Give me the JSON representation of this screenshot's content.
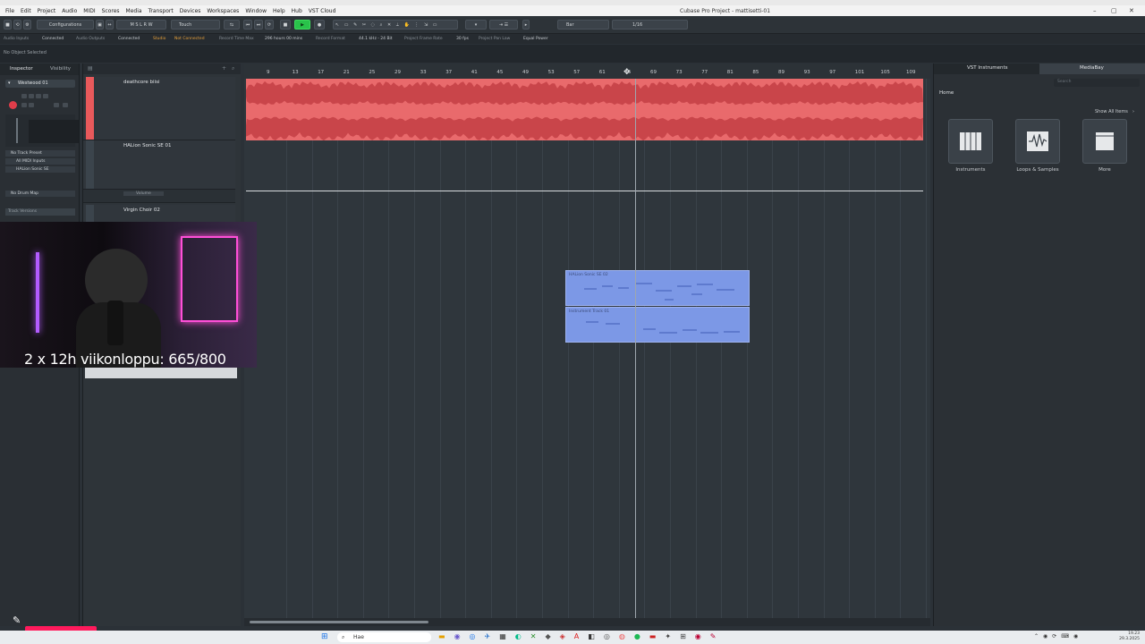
{
  "menubar": {
    "items": [
      "File",
      "Edit",
      "Project",
      "Audio",
      "MIDI",
      "Scores",
      "Media",
      "Transport",
      "Devices",
      "Workspaces",
      "Window",
      "Help",
      "Hub",
      "VST Cloud"
    ],
    "window_title": "Cubase Pro Project - mattisetti-01"
  },
  "toolbar": {
    "configurations": "Configurations",
    "touch_mode": "Touch",
    "grid_type": "Bar",
    "quantize": "1/16"
  },
  "statusline": [
    "Audio Inputs",
    "Connected",
    "Audio Outputs",
    "Connected",
    "Studio",
    "Not Connected",
    "Record Time Max",
    "296 hours 00 mins",
    "Record Format",
    "44.1 kHz - 24 Bit",
    "Project Frame Rate",
    "30 fps",
    "Project Pan Law",
    "Equal Power"
  ],
  "infoline": {
    "text": "No Object Selected"
  },
  "inspector": {
    "tabs": [
      "Inspector",
      "Visibility"
    ],
    "track_name": "Westwood 01",
    "routing": [
      "No Track Preset",
      "All MIDI Inputs",
      "HALion Sonic SE",
      "No Drum Map"
    ],
    "track_versions": "Track Versions"
  },
  "tracks": [
    {
      "name": "deathcore biisi",
      "color": "#e8595b"
    },
    {
      "name": "HALion Sonic SE 01",
      "color": "#39424a"
    },
    {
      "name": "Volume",
      "color": "#39424a"
    },
    {
      "name": "Virgin Choir 02",
      "color": "#39424a"
    }
  ],
  "ruler": [
    "9",
    "13",
    "17",
    "21",
    "25",
    "29",
    "33",
    "37",
    "41",
    "45",
    "49",
    "53",
    "57",
    "61",
    "65",
    "69",
    "73",
    "77",
    "81",
    "85",
    "89",
    "93",
    "97",
    "101",
    "105",
    "109"
  ],
  "events": {
    "midi_1": "HALion Sonic SE 02",
    "midi_2": "Instrument Track 01"
  },
  "rightzone": {
    "tabs": [
      "VST Instruments",
      "MediaBay"
    ],
    "home": "Home",
    "search_placeholder": "Search",
    "show_all": "Show All Items",
    "tiles": [
      {
        "label": "Instruments",
        "icon": "piano-keys-icon"
      },
      {
        "label": "Loops & Samples",
        "icon": "waveform-icon"
      },
      {
        "label": "More",
        "icon": "more-icon"
      }
    ]
  },
  "overlay": {
    "text": "2 x 12h viikonloppu: 665/800"
  },
  "taskbar": {
    "search": "Hae",
    "time": "19.23",
    "date": "29.3.2025"
  },
  "colors": {
    "audio_event": "#e96a6c",
    "midi_event": "#7c98e6",
    "record_red": "#ff1a5c"
  }
}
